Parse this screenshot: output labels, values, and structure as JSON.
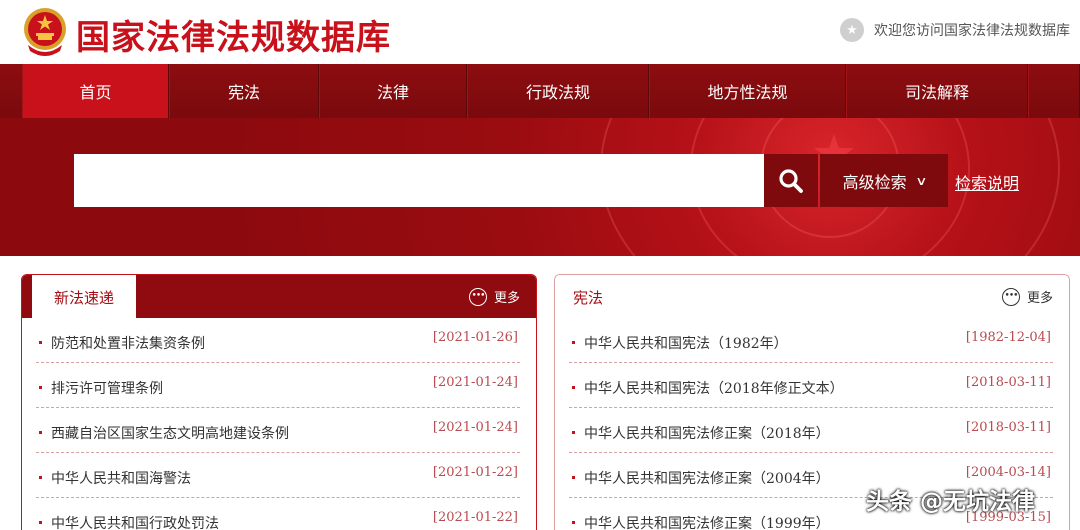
{
  "header": {
    "site_title": "国家法律法规数据库",
    "welcome_text": "欢迎您访问国家法律法规数据库"
  },
  "nav": {
    "items": [
      "首页",
      "宪法",
      "法律",
      "行政法规",
      "地方性法规",
      "司法解释"
    ]
  },
  "search": {
    "value": "",
    "placeholder": "",
    "advanced_label": "高级检索",
    "help_label": "检索说明"
  },
  "panels": {
    "new_laws": {
      "title": "新法速递",
      "more_label": "更多",
      "items": [
        {
          "title": "防范和处置非法集资条例",
          "date": "[2021-01-26]"
        },
        {
          "title": "排污许可管理条例",
          "date": "[2021-01-24]"
        },
        {
          "title": "西藏自治区国家生态文明高地建设条例",
          "date": "[2021-01-24]"
        },
        {
          "title": "中华人民共和国海警法",
          "date": "[2021-01-22]"
        },
        {
          "title": "中华人民共和国行政处罚法",
          "date": "[2021-01-22]"
        }
      ]
    },
    "constitution": {
      "title": "宪法",
      "more_label": "更多",
      "items": [
        {
          "title": "中华人民共和国宪法（1982年）",
          "date": "[1982-12-04]"
        },
        {
          "title": "中华人民共和国宪法（2018年修正文本）",
          "date": "[2018-03-11]"
        },
        {
          "title": "中华人民共和国宪法修正案（2018年）",
          "date": "[2018-03-11]"
        },
        {
          "title": "中华人民共和国宪法修正案（2004年）",
          "date": "[2004-03-14]"
        },
        {
          "title": "中华人民共和国宪法修正案（1999年）",
          "date": "[1999-03-15]"
        }
      ]
    }
  },
  "watermark": "头条 @无坑法律",
  "colors": {
    "brand_red": "#c8111a",
    "nav_dark": "#7a0a0d",
    "date_red": "#b94a4f"
  }
}
